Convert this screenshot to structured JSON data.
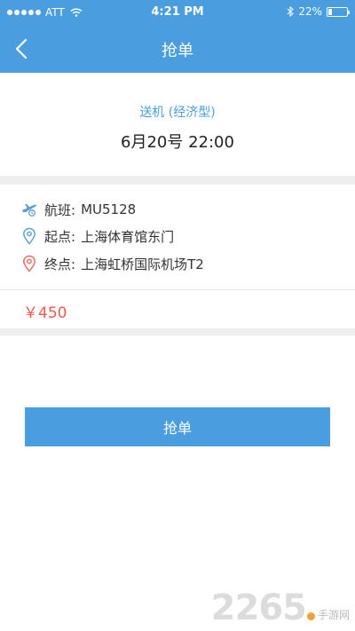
{
  "status_bar": {
    "carrier": "ATT",
    "time": "4:21 PM",
    "battery_text": "22%",
    "battery_level": 0.22
  },
  "header": {
    "title": "抢单",
    "back_icon": "chevron-left-icon"
  },
  "order": {
    "type": "送机 (经济型)",
    "datetime": "6月20号   22:00",
    "flight_label": "航班:",
    "flight_value": "MU5128",
    "start_label": "起点:",
    "start_value": "上海体育馆东门",
    "end_label": "终点:",
    "end_value": "上海虹桥国际机场T2",
    "price": "￥450"
  },
  "actions": {
    "grab_label": "抢单"
  },
  "watermark": {
    "number": "2265",
    "suffix": "手游网"
  },
  "colors": {
    "accent": "#4a9ee0",
    "price": "#f05a4a",
    "background_gap": "#eeeeee"
  }
}
